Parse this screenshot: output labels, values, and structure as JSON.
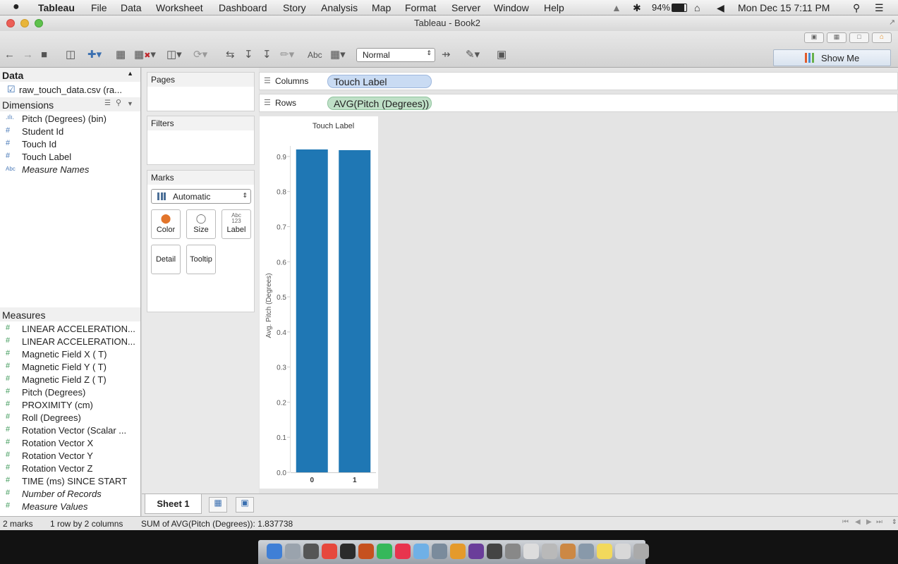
{
  "menubar": {
    "app": "Tableau",
    "items": [
      "File",
      "Data",
      "Worksheet",
      "Dashboard",
      "Story",
      "Analysis",
      "Map",
      "Format",
      "Server",
      "Window",
      "Help"
    ],
    "battery": "94%",
    "datetime": "Mon Dec 15  7:11 PM"
  },
  "window": {
    "title": "Tableau - Book2"
  },
  "toolbar": {
    "fit_select": "Normal",
    "abc_label": "Abc",
    "show_me": "Show Me"
  },
  "data_pane": {
    "header": "Data",
    "datasource": "raw_touch_data.csv (ra...",
    "dimensions_header": "Dimensions",
    "dimensions": [
      {
        "icon": ".ılı.",
        "label": "Pitch (Degrees) (bin)",
        "italic": false
      },
      {
        "icon": "#",
        "label": "Student Id",
        "italic": false
      },
      {
        "icon": "#",
        "label": "Touch Id",
        "italic": false
      },
      {
        "icon": "#",
        "label": "Touch Label",
        "italic": false
      },
      {
        "icon": "Abc",
        "label": "Measure Names",
        "italic": true
      }
    ],
    "measures_header": "Measures",
    "measures": [
      {
        "label": "LINEAR ACCELERATION...",
        "italic": false
      },
      {
        "label": "LINEAR ACCELERATION...",
        "italic": false
      },
      {
        "label": "Magnetic Field X ( T)",
        "italic": false
      },
      {
        "label": "Magnetic Field Y ( T)",
        "italic": false
      },
      {
        "label": "Magnetic Field Z ( T)",
        "italic": false
      },
      {
        "label": "Pitch (Degrees)",
        "italic": false
      },
      {
        "label": "PROXIMITY (cm)",
        "italic": false
      },
      {
        "label": "Roll (Degrees)",
        "italic": false
      },
      {
        "label": "Rotation Vector (Scalar ...",
        "italic": false
      },
      {
        "label": "Rotation Vector X",
        "italic": false
      },
      {
        "label": "Rotation Vector Y",
        "italic": false
      },
      {
        "label": "Rotation Vector Z",
        "italic": false
      },
      {
        "label": "TIME (ms) SINCE START",
        "italic": false
      },
      {
        "label": "Number of Records",
        "italic": true
      },
      {
        "label": "Measure Values",
        "italic": true
      }
    ]
  },
  "cards": {
    "pages": "Pages",
    "filters": "Filters",
    "marks": "Marks",
    "mark_type": "Automatic",
    "buttons": [
      "Color",
      "Size",
      "Label",
      "Detail",
      "Tooltip"
    ]
  },
  "shelves": {
    "columns_label": "Columns",
    "columns_pill": "Touch Label",
    "rows_label": "Rows",
    "rows_pill": "AVG(Pitch (Degrees))"
  },
  "chart_data": {
    "type": "bar",
    "title": "Touch Label",
    "categories": [
      "0",
      "1"
    ],
    "values": [
      0.92,
      0.918
    ],
    "ylabel": "Avg. Pitch (Degrees)",
    "ylim": [
      0,
      0.93
    ],
    "yticks": [
      "0.0",
      "0.1",
      "0.2",
      "0.3",
      "0.4",
      "0.5",
      "0.6",
      "0.7",
      "0.8",
      "0.9"
    ],
    "bar_color": "#1f77b4"
  },
  "tabs": {
    "sheet": "Sheet 1"
  },
  "status": {
    "marks": "2 marks",
    "dims": "1 row by 2 columns",
    "sum": "SUM of AVG(Pitch (Degrees)): 1.837738"
  }
}
